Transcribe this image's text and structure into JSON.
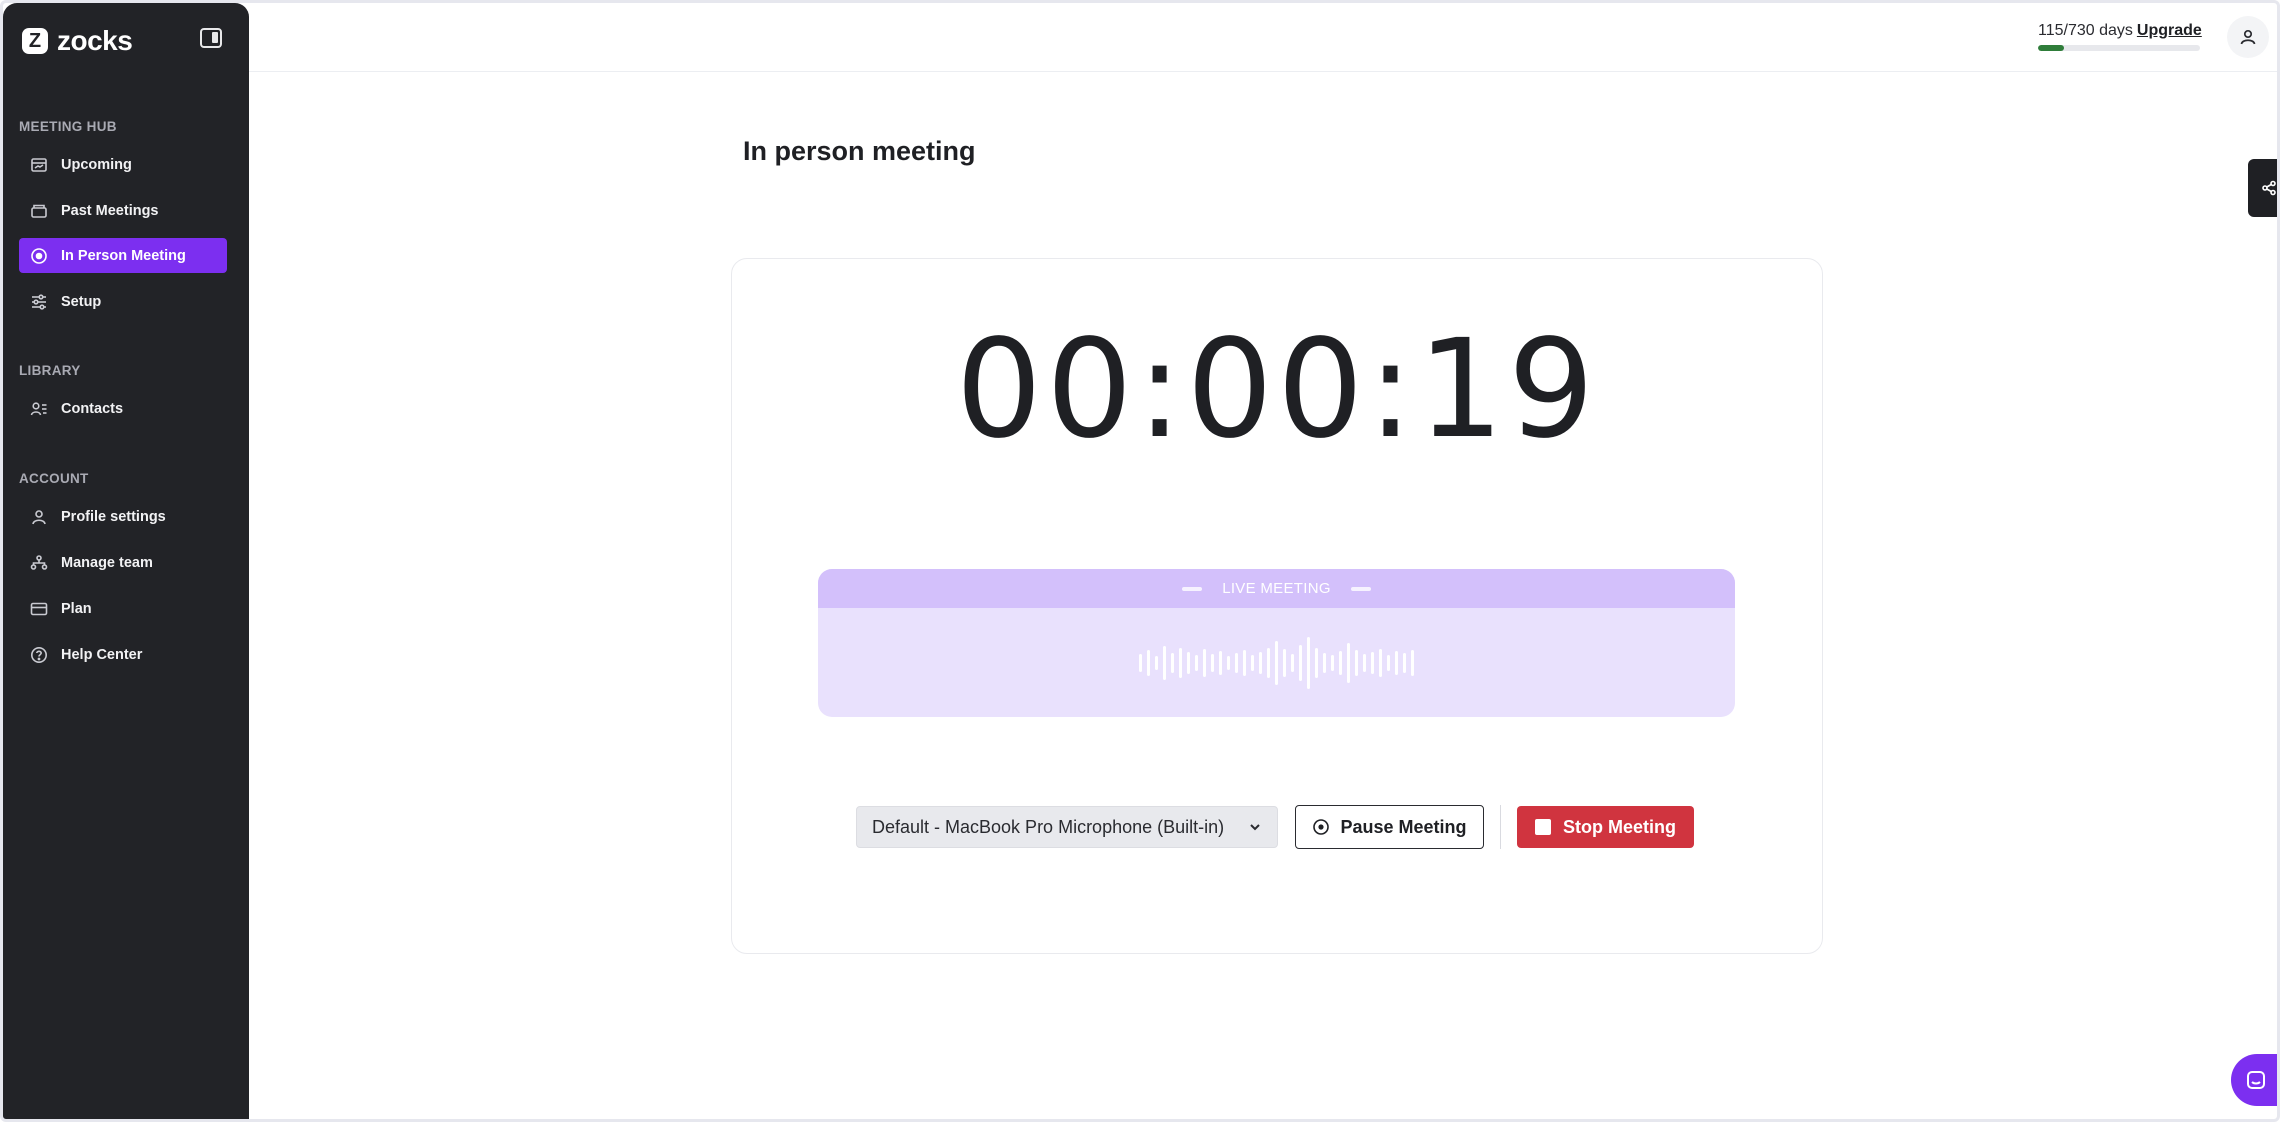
{
  "app": {
    "logo_text": "zocks",
    "logo_mark": "Z"
  },
  "sidebar": {
    "sections": {
      "meeting_hub": "MEETING HUB",
      "library": "LIBRARY",
      "account": "ACCOUNT"
    },
    "items": [
      {
        "label": "Upcoming",
        "icon": "calendar-icon"
      },
      {
        "label": "Past Meetings",
        "icon": "folder-icon"
      },
      {
        "label": "In Person Meeting",
        "icon": "record-icon",
        "active": true
      },
      {
        "label": "Setup",
        "icon": "sliders-icon"
      },
      {
        "label": "Contacts",
        "icon": "contacts-icon"
      },
      {
        "label": "Profile settings",
        "icon": "user-icon"
      },
      {
        "label": "Manage team",
        "icon": "team-icon"
      },
      {
        "label": "Plan",
        "icon": "card-icon"
      },
      {
        "label": "Help Center",
        "icon": "help-icon"
      }
    ]
  },
  "topbar": {
    "trial_text": "115/730 days",
    "upgrade_label": "Upgrade",
    "trial_progress": 0.1575
  },
  "main": {
    "title": "In person meeting",
    "timer": "00:00:19",
    "live_label": "LIVE MEETING",
    "mic_select_value": "Default - MacBook Pro Microphone (Built-in)",
    "pause_label": "Pause Meeting",
    "stop_label": "Stop Meeting"
  },
  "colors": {
    "sidebar_bg": "#222327",
    "accent": "#7c2ff0",
    "stop": "#d0343f",
    "live_header": "#d3c0fb",
    "live_body": "#e9e1fd",
    "trial_fill": "#2f7d3a"
  }
}
